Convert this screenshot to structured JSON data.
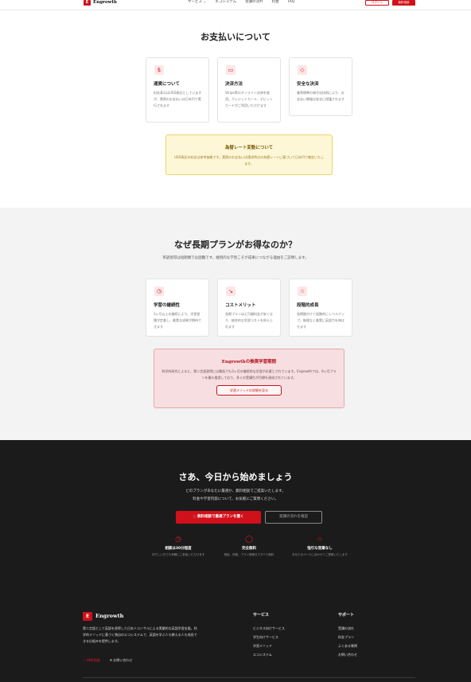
{
  "header": {
    "logo_mark": "E",
    "brand": "Engrowth",
    "nav": [
      "サービス ⌄",
      "エコシステム",
      "受講の流れ",
      "料金",
      "FAQ"
    ],
    "login_label": "ログイン",
    "signup_label": "無料相談"
  },
  "payment": {
    "title": "お支払いについて",
    "cards": [
      {
        "icon": "$",
        "title": "通貨について",
        "text": "料金表示はUSD表記としていますが、実際のお支払いは日本円で実行されます"
      },
      {
        "icon": "▭",
        "title": "決済方法",
        "text": "Stripe等のオンライン決済を使用。クレジットカード、デビットカードがご利用いただけます"
      },
      {
        "icon": "◇",
        "title": "安全な決済",
        "text": "業界標準の暗号化技術により、お支払い情報は安全に保護されます"
      }
    ],
    "notice_title": "為替レート変動について",
    "notice_text": "USD表記の料金は参考価格です。実際のお支払いは請求時点の為替レートに基づいて日本円で確定いたします。"
  },
  "longterm": {
    "title": "なぜ長期プランがお得なのか？",
    "subtitle": "英語習得は短期間では困難です。継続的な学習こそが成果につながる理由をご説明します。",
    "cards": [
      {
        "icon": "◷",
        "title": "学習の継続性",
        "text": "3ヶ月以上の継続により、学習習慣が定着し、着実な成果が期待できます"
      },
      {
        "icon": "↘",
        "title": "コストメリット",
        "text": "長期プランほど月額料金が安くなり、総合的な学習コストを抑えられます"
      },
      {
        "icon": "☆",
        "title": "段階的成長",
        "text": "長期間かけて段階的にレベルアップ。無理なく着実に英語力を伸ばせます"
      }
    ],
    "notice_title": "Engrowthの推奨学習期間",
    "notice_text": "科学的研究によると、第二言語習得には最低でも3ヶ月の継続的な学習が必要とされています。Engrowthでは、6ヶ月プランを最も推奨しており、多くの受講生が目標を達成されています。",
    "notice_button": "学習メソッドの詳細を見る"
  },
  "cta": {
    "title": "さあ、今日から始めましょう",
    "line1": "どのプランがあなたに最適か、無料相談でご提案いたします。",
    "line2": "料金や学習内容について、お気軽にご質問ください。",
    "primary_button": "無料相談で最適プランを聞く",
    "secondary_button": "受講の流れを確認",
    "features": [
      {
        "icon": "◷",
        "title": "相談は30分程度",
        "text": "お忙しい方でも気軽にご参加いただけます"
      },
      {
        "icon": "◯",
        "title": "完全無料",
        "text": "相談、診断、プラン提案まですべて無料"
      },
      {
        "icon": "☆",
        "title": "強引な営業なし",
        "text": "あなたのペースに合わせてご提案いたします"
      }
    ]
  },
  "footer": {
    "logo_mark": "E",
    "brand": "Engrowth",
    "description": "第二言語として英語を習得した日本人コンサルによる実績的な英語学習支援。科学的メソッドに基づく独自のエコシステムで、英語を学ぶ人も教える人も成長できる仕組みを提供します。",
    "link_line": "LINE相談",
    "link_contact": "お問い合わせ",
    "col1_title": "サービス",
    "col1_items": [
      "ビジネス向けサービス",
      "学生向けサービス",
      "学習メソッド",
      "エコシステム"
    ],
    "col2_title": "サポート",
    "col2_items": [
      "受講の流れ",
      "料金プラン",
      "よくある質問",
      "お問い合わせ"
    ]
  }
}
